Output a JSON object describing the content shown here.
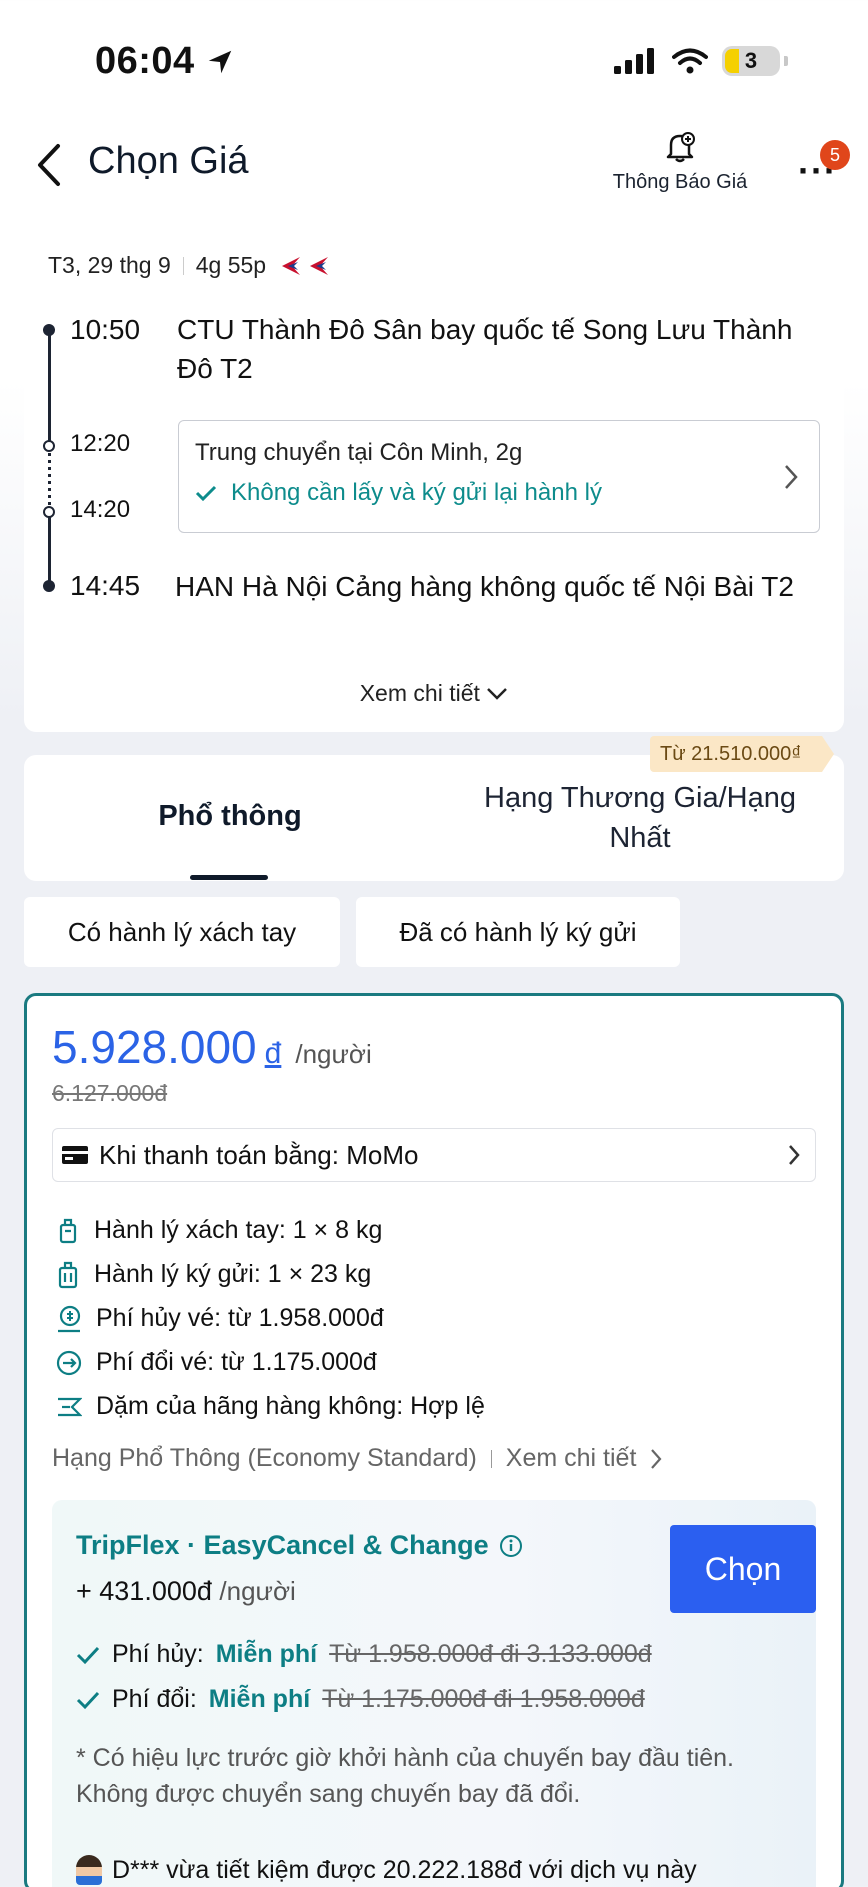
{
  "status_bar": {
    "time": "06:04",
    "battery": "3"
  },
  "header": {
    "title": "Chọn Giá",
    "notify_label": "Thông Báo Giá",
    "more_badge": "5",
    "more_symbol": "···"
  },
  "flight": {
    "date": "T3, 29 thg 9",
    "duration": "4g 55p",
    "depart_time": "10:50",
    "depart_place": "CTU Thành Đô Sân bay quốc tế Song Lưu Thành Đô T2",
    "transit_arrive_time": "12:20",
    "transit_depart_time": "14:20",
    "transit_text": "Trung chuyển tại Côn Minh, 2g",
    "transit_baggage": "Không cần lấy và ký gửi lại hành lý",
    "arrive_time": "14:45",
    "arrive_place": "HAN Hà Nội Cảng hàng không quốc tế Nội Bài T2",
    "details_link": "Xem chi tiết"
  },
  "tabs": {
    "economy": "Phổ thông",
    "business": "Hạng Thương Gia/Hạng Nhất",
    "business_from": "Từ 21.510.000₫"
  },
  "filters": [
    "Có hành lý xách tay",
    "Đã có hành lý ký gửi"
  ],
  "fare": {
    "price": "5.928.000",
    "currency": "đ",
    "per": "/người",
    "old_price": "6.127.000đ",
    "payment": "Khi thanh toán bằng: MoMo",
    "features": [
      "Hành lý xách tay: 1 × 8 kg",
      "Hành lý ký gửi: 1 × 23 kg",
      "Phí hủy vé: từ 1.958.000đ",
      "Phí đổi vé: từ 1.175.000đ",
      "Dặm của hãng hàng không: Hợp lệ"
    ],
    "class_name": "Hạng Phổ Thông (Economy Standard)",
    "class_details": "Xem chi tiết"
  },
  "tripflex": {
    "title": "TripFlex · EasyCancel & Change",
    "price": "+ 431.000đ",
    "per": "/người",
    "choose": "Chọn",
    "cancel_label": "Phí hủy:",
    "cancel_free": "Miễn phí",
    "cancel_old": "Từ 1.958.000đ đi 3.133.000đ",
    "change_label": "Phí đổi:",
    "change_free": "Miễn phí",
    "change_old": "Từ 1.175.000đ đi 1.958.000đ",
    "note": "* Có hiệu lực trước giờ khởi hành của chuyến bay đầu tiên. Không được chuyển sang chuyến bay đã đổi.",
    "saved": "D*** vừa tiết kiệm được 20.222.188đ với dịch vụ này"
  },
  "colors": {
    "accent_blue": "#2b63e6",
    "teal": "#0d7e84",
    "badge": "#e0461b"
  }
}
